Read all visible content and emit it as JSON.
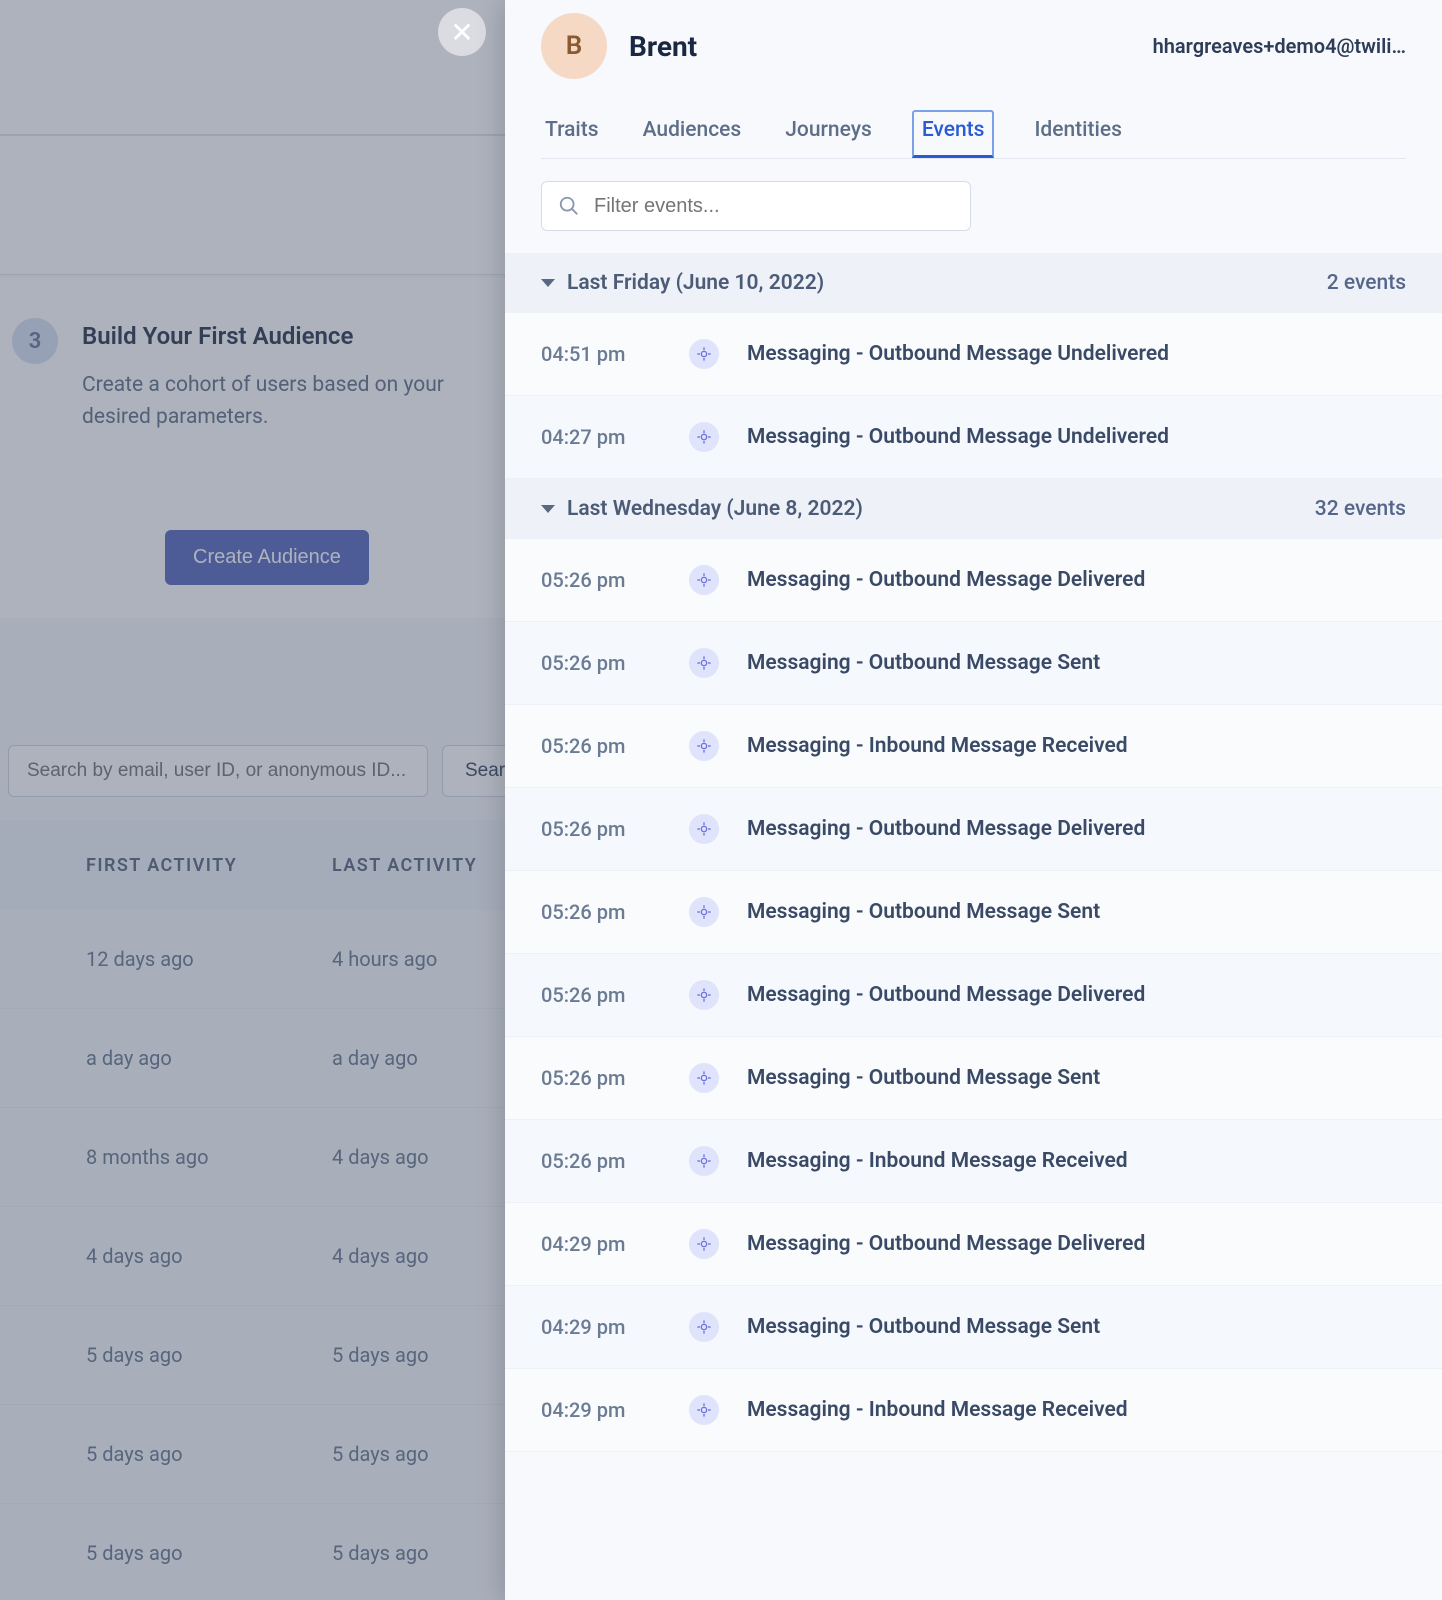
{
  "background": {
    "step_number": "3",
    "card_title": "Build Your First Audience",
    "card_desc": "Create a cohort of users based on your desired parameters.",
    "create_button": "Create Audience",
    "search_placeholder": "Search by email, user ID, or anonymous ID...",
    "search_button": "Search",
    "columns": {
      "first": "FIRST ACTIVITY",
      "last": "LAST ACTIVITY"
    },
    "rows": [
      {
        "first": "12 days ago",
        "last": "4 hours ago"
      },
      {
        "first": "a day ago",
        "last": "a day ago"
      },
      {
        "first": "8 months ago",
        "last": "4 days ago"
      },
      {
        "first": "4 days ago",
        "last": "4 days ago"
      },
      {
        "first": "5 days ago",
        "last": "5 days ago"
      },
      {
        "first": "5 days ago",
        "last": "5 days ago"
      },
      {
        "first": "5 days ago",
        "last": "5 days ago"
      }
    ]
  },
  "drawer": {
    "avatar_initial": "B",
    "name": "Brent",
    "email": "hhargreaves+demo4@twili…",
    "tabs": [
      {
        "label": "Traits",
        "active": false
      },
      {
        "label": "Audiences",
        "active": false
      },
      {
        "label": "Journeys",
        "active": false
      },
      {
        "label": "Events",
        "active": true
      },
      {
        "label": "Identities",
        "active": false
      }
    ],
    "filter_placeholder": "Filter events...",
    "groups": [
      {
        "label": "Last Friday (June 10, 2022)",
        "count": "2 events",
        "events": [
          {
            "time": "04:51 pm",
            "name": "Messaging - Outbound Message Undelivered"
          },
          {
            "time": "04:27 pm",
            "name": "Messaging - Outbound Message Undelivered"
          }
        ]
      },
      {
        "label": "Last Wednesday (June 8, 2022)",
        "count": "32 events",
        "events": [
          {
            "time": "05:26 pm",
            "name": "Messaging - Outbound Message Delivered"
          },
          {
            "time": "05:26 pm",
            "name": "Messaging - Outbound Message Sent"
          },
          {
            "time": "05:26 pm",
            "name": "Messaging - Inbound Message Received"
          },
          {
            "time": "05:26 pm",
            "name": "Messaging - Outbound Message Delivered"
          },
          {
            "time": "05:26 pm",
            "name": "Messaging - Outbound Message Sent"
          },
          {
            "time": "05:26 pm",
            "name": "Messaging - Outbound Message Delivered"
          },
          {
            "time": "05:26 pm",
            "name": "Messaging - Outbound Message Sent"
          },
          {
            "time": "05:26 pm",
            "name": "Messaging - Inbound Message Received"
          },
          {
            "time": "04:29 pm",
            "name": "Messaging - Outbound Message Delivered"
          },
          {
            "time": "04:29 pm",
            "name": "Messaging - Outbound Message Sent"
          },
          {
            "time": "04:29 pm",
            "name": "Messaging - Inbound Message Received"
          }
        ]
      }
    ]
  }
}
